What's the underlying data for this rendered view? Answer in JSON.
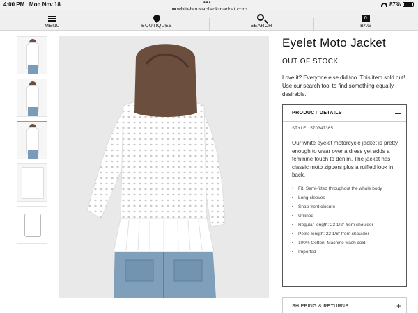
{
  "status_bar": {
    "time": "4:00 PM",
    "date": "Mon Nov 18",
    "url": "whitehouseblackmarket.com",
    "battery": "87%"
  },
  "nav": {
    "menu": "MENU",
    "boutiques": "BOUTIQUES",
    "search": "SEARCH",
    "bag": "BAG",
    "bag_count": "0"
  },
  "product": {
    "title": "Eyelet Moto Jacket",
    "stock_status": "OUT OF STOCK",
    "blurb": "Love it? Everyone else did too. This item sold out! Use our search tool to find something equally desirable.",
    "details": {
      "heading": "PRODUCT DETAILS",
      "style": "STYLE : 570347365",
      "description": "Our white eyelet motorcycle jacket is pretty enough to wear over a dress yet adds a feminine touch to denim. The jacket has classic moto zippers plus a ruffled look in back.",
      "features": [
        "Fit: Semi-fitted throughout the whole body",
        "Long-sleeves",
        "Snap-front closure",
        "Unlined",
        "Regular length: 23 1/2\" from shoulder",
        "Petite length: 22 1/8\" from shoulder",
        "100% Cotton. Machine wash cold",
        "Imported"
      ]
    },
    "shipping": "SHIPPING & RETURNS"
  },
  "colors": {
    "nav_bg": "#efefef",
    "jacket": "#ffffff",
    "hair": "#6b4e3d",
    "denim": "#7a9cb8"
  }
}
